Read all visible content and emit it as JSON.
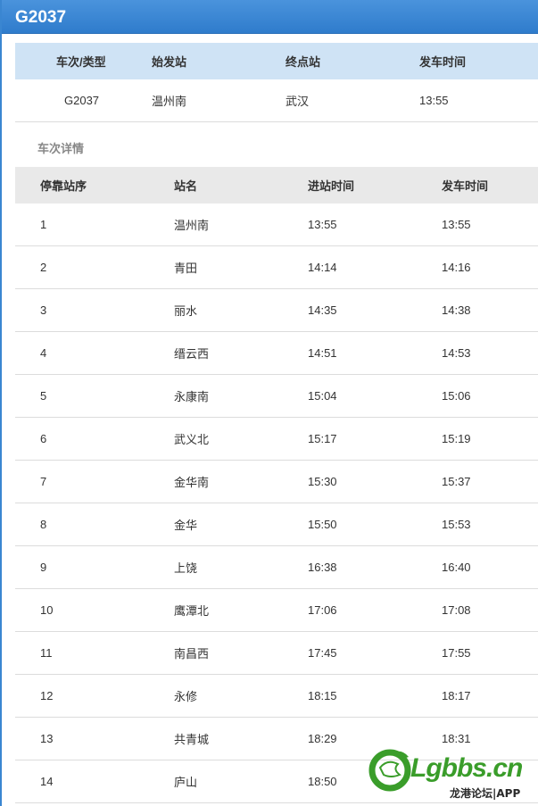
{
  "header": {
    "title": "G2037"
  },
  "summary": {
    "columns": [
      "车次/类型",
      "始发站",
      "终点站",
      "发车时间"
    ],
    "row": [
      "G2037",
      "温州南",
      "武汉",
      "13:55"
    ]
  },
  "details": {
    "label": "车次详情",
    "columns": [
      "停靠站序",
      "站名",
      "进站时间",
      "发车时间"
    ],
    "rows": [
      [
        "1",
        "温州南",
        "13:55",
        "13:55"
      ],
      [
        "2",
        "青田",
        "14:14",
        "14:16"
      ],
      [
        "3",
        "丽水",
        "14:35",
        "14:38"
      ],
      [
        "4",
        "缙云西",
        "14:51",
        "14:53"
      ],
      [
        "5",
        "永康南",
        "15:04",
        "15:06"
      ],
      [
        "6",
        "武义北",
        "15:17",
        "15:19"
      ],
      [
        "7",
        "金华南",
        "15:30",
        "15:37"
      ],
      [
        "8",
        "金华",
        "15:50",
        "15:53"
      ],
      [
        "9",
        "上饶",
        "16:38",
        "16:40"
      ],
      [
        "10",
        "鹰潭北",
        "17:06",
        "17:08"
      ],
      [
        "11",
        "南昌西",
        "17:45",
        "17:55"
      ],
      [
        "12",
        "永修",
        "18:15",
        "18:17"
      ],
      [
        "13",
        "共青城",
        "18:29",
        "18:31"
      ],
      [
        "14",
        "庐山",
        "18:50",
        ""
      ]
    ]
  },
  "watermark": {
    "brand": "Lgbbs.cn",
    "subtitle": "龙港论坛|APP",
    "logo_icon": "dragon-logo-icon"
  },
  "colors": {
    "title_bar": "#3a86d1",
    "summary_header": "#cfe3f5",
    "detail_header": "#e9e9e9",
    "watermark_green": "#3a9d2a"
  }
}
